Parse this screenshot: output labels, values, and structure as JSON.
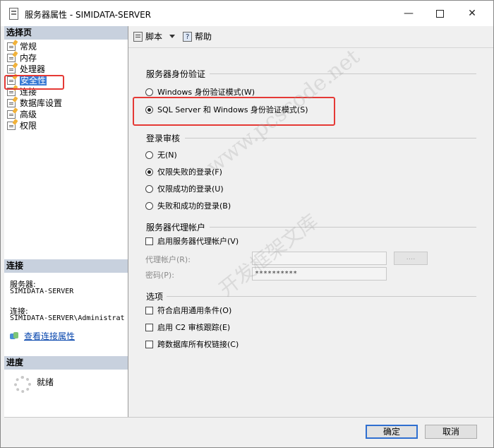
{
  "window": {
    "title": "服务器属性 - SIMIDATA-SERVER"
  },
  "left_panel": {
    "select_page_header": "选择页",
    "pages": [
      {
        "label": "常规",
        "selected": false
      },
      {
        "label": "内存",
        "selected": false
      },
      {
        "label": "处理器",
        "selected": false
      },
      {
        "label": "安全性",
        "selected": true
      },
      {
        "label": "连接",
        "selected": false
      },
      {
        "label": "数据库设置",
        "selected": false
      },
      {
        "label": "高级",
        "selected": false
      },
      {
        "label": "权限",
        "selected": false
      }
    ],
    "connection_header": "连接",
    "server_label": "服务器:",
    "server_value": "SIMIDATA-SERVER",
    "connection_label": "连接:",
    "connection_value": "SIMIDATA-SERVER\\Administrat",
    "view_connection_link": "查看连接属性",
    "progress_header": "进度",
    "progress_status": "就绪"
  },
  "toolbar": {
    "script_label": "脚本",
    "help_label": "帮助"
  },
  "server_auth": {
    "title": "服务器身份验证",
    "options": [
      {
        "label": "Windows 身份验证模式(W)",
        "checked": false
      },
      {
        "label": "SQL Server 和 Windows 身份验证模式(S)",
        "checked": true
      }
    ]
  },
  "login_audit": {
    "title": "登录审核",
    "options": [
      {
        "label": "无(N)",
        "checked": false
      },
      {
        "label": "仅限失败的登录(F)",
        "checked": true
      },
      {
        "label": "仅限成功的登录(U)",
        "checked": false
      },
      {
        "label": "失败和成功的登录(B)",
        "checked": false
      }
    ]
  },
  "proxy_account": {
    "title": "服务器代理帐户",
    "enable_label": "启用服务器代理帐户(V)",
    "account_label": "代理帐户(R):",
    "account_value": "",
    "password_label": "密码(P):",
    "password_value": "**********",
    "browse_label": "...."
  },
  "options": {
    "title": "选项",
    "items": [
      {
        "label": "符合启用通用条件(O)",
        "checked": false
      },
      {
        "label": "启用 C2 审核跟踪(E)",
        "checked": false
      },
      {
        "label": "跨数据库所有权链接(C)",
        "checked": false
      }
    ]
  },
  "footer": {
    "ok_label": "确定",
    "cancel_label": "取消"
  },
  "watermark": {
    "line1": "www.pcscode.net",
    "line2": "开发框架文库"
  },
  "colors": {
    "highlight": "#e53935",
    "selection": "#3a7bd5",
    "section_header": "#c8d1de"
  }
}
